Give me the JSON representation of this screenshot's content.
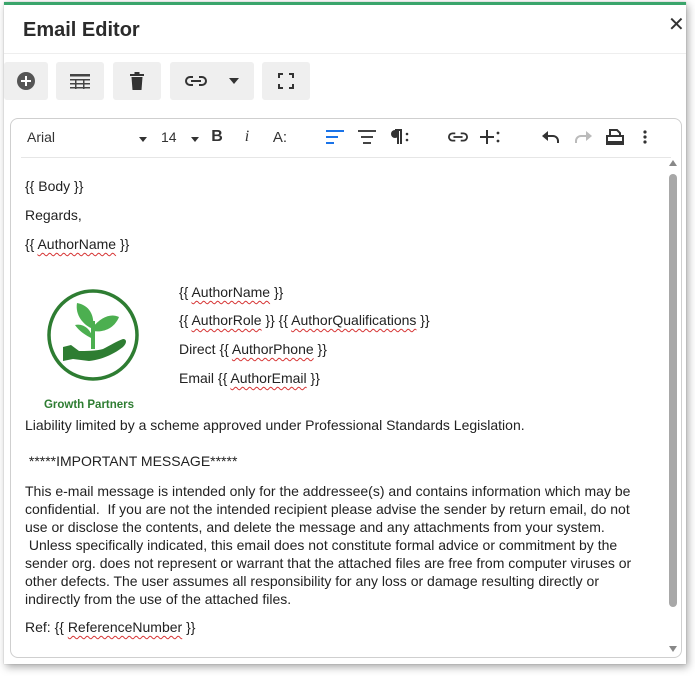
{
  "dialog": {
    "title": "Email Editor",
    "close_glyph": "✕"
  },
  "toolbar": {
    "icons": [
      "add-circle-icon",
      "table-icon",
      "delete-icon",
      "link-icon",
      "chevron-down-icon",
      "fullscreen-icon"
    ]
  },
  "editor_toolbar": {
    "font_family": "Arial",
    "font_size": "14",
    "bold": "B",
    "italic": "i",
    "text_size": "A:",
    "icons": [
      "align-left-icon",
      "align-center-icon",
      "paragraph-format-icon",
      "link-icon",
      "insert-more-icon",
      "undo-icon",
      "redo-icon",
      "print-icon",
      "more-vertical-icon"
    ]
  },
  "body": {
    "l1": "{{ Body }}",
    "l2": "Regards,",
    "l3_pre": "{{ ",
    "l3_var": "AuthorName",
    "l3_post": " }}",
    "sig_name_pre": "{{ ",
    "sig_name_var": "AuthorName",
    "sig_name_post": " }}",
    "sig_role_pre": "{{ ",
    "sig_role_var": "AuthorRole",
    "sig_role_mid": " }} {{ ",
    "sig_qual_var": "AuthorQualifications",
    "sig_qual_post": " }}",
    "sig_phone_pre": "Direct {{ ",
    "sig_phone_var": "AuthorPhone",
    "sig_phone_post": " }}",
    "sig_email_pre": "Email {{ ",
    "sig_email_var": "AuthorEmail",
    "sig_email_post": " }}",
    "logo_text": "Growth Partners",
    "liability": "Liability limited by a scheme approved under Professional Standards Legislation.",
    "important": " *****IMPORTANT MESSAGE*****",
    "disclaimer_1": "This e-mail message is intended only for the addressee(s) and contains information which may be",
    "disclaimer_2": "confidential.  If you are not the intended recipient please advise the sender by return email, do not",
    "disclaimer_3": "use or disclose the contents, and delete the message and any attachments from your system.",
    "disclaimer_4": " Unless specifically indicated, this email does not constitute formal advice or commitment by the",
    "disclaimer_5": "sender org. does not represent or warrant that the attached files are free from computer viruses or",
    "disclaimer_6": "other defects. The user assumes all responsibility for any loss or damage resulting directly or",
    "disclaimer_7": "indirectly from the use of the attached files.",
    "ref_pre": "Ref: {{ ",
    "ref_var": "ReferenceNumber",
    "ref_post": " }}"
  },
  "colors": {
    "accent": "#3aa56b",
    "logo_green": "#2e7d32",
    "active_icon": "#1a73e8"
  }
}
